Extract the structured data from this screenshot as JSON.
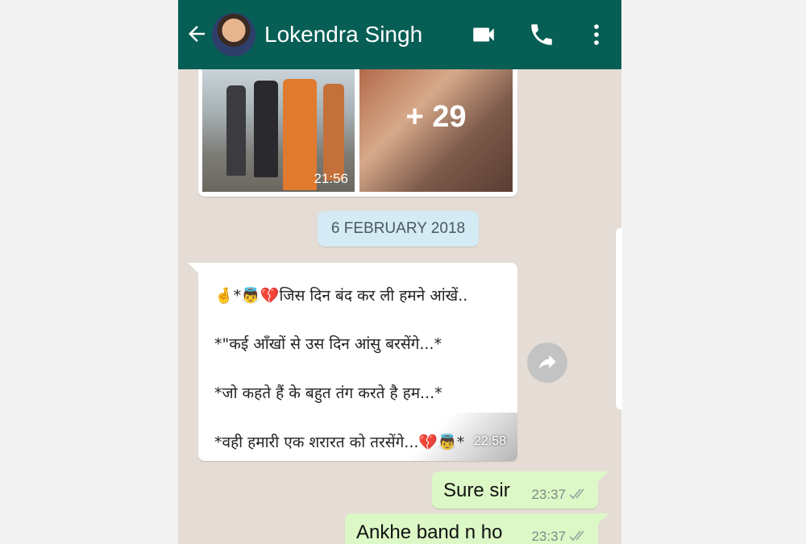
{
  "header": {
    "contact_name": "Lokendra Singh",
    "icons": [
      "back-arrow-icon",
      "video-call-icon",
      "phone-icon",
      "more-vert-icon"
    ],
    "color": "#075e54"
  },
  "media_message": {
    "time": "21:56",
    "more_count": "+ 29"
  },
  "date_chip": "6 FEBRUARY 2018",
  "incoming_message": {
    "lines": [
      "🤞*👼💔जिस दिन बंद कर ली हमने आंखें..",
      "*\"कई आँखों से उस दिन आंसु बरसेंगे...*",
      "*जो कहते हैं के बहुत तंग करते है हम...*",
      "*वही हमारी एक शरारत को तरसेंगे...💔👼*"
    ],
    "time": "22:58"
  },
  "outgoing_messages": [
    {
      "text": "Sure sir",
      "time": "23:37"
    },
    {
      "text": "Ankhe band n ho",
      "time": "23:37"
    }
  ],
  "colors": {
    "chat_background": "#e5ddd5",
    "outgoing_bubble": "#dcf8c6",
    "date_chip": "#d4eaf4"
  }
}
